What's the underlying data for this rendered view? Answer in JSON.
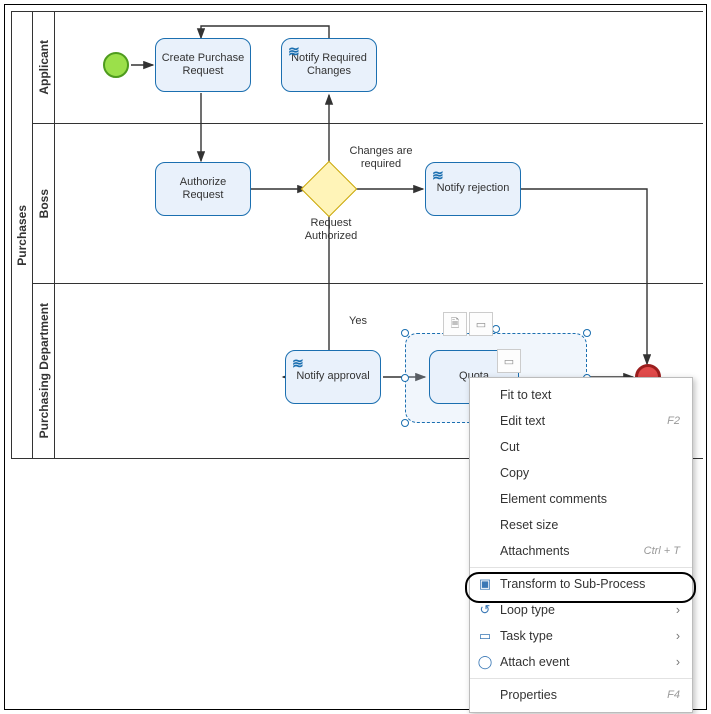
{
  "pool": {
    "name": "Purchases"
  },
  "lanes": {
    "applicant": {
      "name": "Applicant"
    },
    "boss": {
      "name": "Boss"
    },
    "purchasing": {
      "name": "Purchasing Department"
    }
  },
  "tasks": {
    "create_request": "Create Purchase Request",
    "notify_changes": "Notify Required Changes",
    "authorize": "Authorize Request",
    "notify_rejection": "Notify rejection",
    "notify_approval": "Notify approval",
    "quotations": "Quota"
  },
  "gateway_labels": {
    "changes_required": "Changes are required",
    "authorized": "Request Authorized",
    "yes": "Yes"
  },
  "context_menu": {
    "fit_to_text": "Fit to text",
    "edit_text": "Edit text",
    "edit_text_kb": "F2",
    "cut": "Cut",
    "copy": "Copy",
    "element_comments": "Element comments",
    "reset_size": "Reset size",
    "attachments": "Attachments",
    "attachments_kb": "Ctrl + T",
    "transform_subprocess": "Transform to Sub-Process",
    "loop_type": "Loop type",
    "task_type": "Task type",
    "attach_event": "Attach event",
    "properties": "Properties",
    "properties_kb": "F4"
  }
}
